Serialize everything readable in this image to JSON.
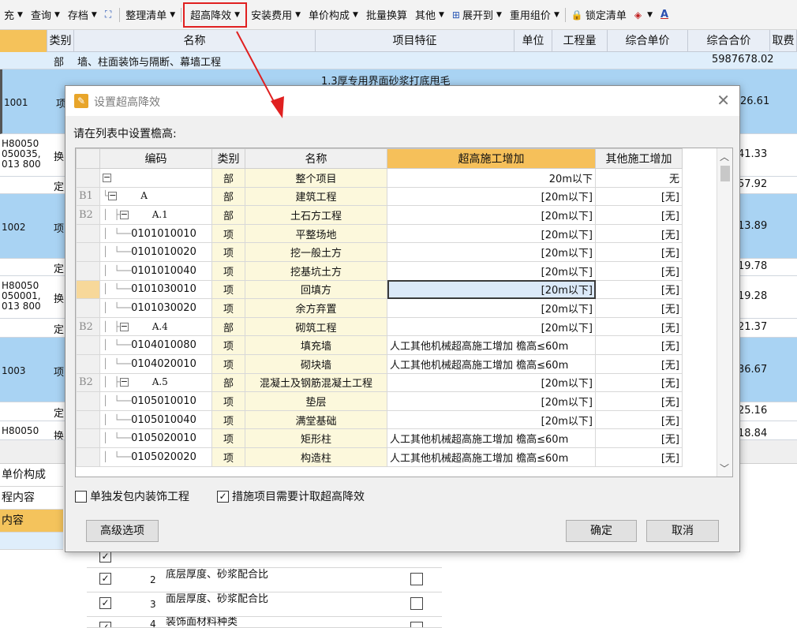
{
  "toolbar": {
    "items": [
      {
        "label": "充",
        "arrow": true
      },
      {
        "label": "查询",
        "arrow": true
      },
      {
        "label": "存档",
        "arrow": true
      },
      {
        "label": "整理清单",
        "arrow": true
      },
      {
        "label": "超高降效",
        "arrow": true
      },
      {
        "label": "安装费用",
        "arrow": true
      },
      {
        "label": "单价构成",
        "arrow": true
      },
      {
        "label": "批量换算"
      },
      {
        "label": "其他",
        "arrow": true
      },
      {
        "label": "展开到",
        "arrow": true
      },
      {
        "label": "重用组价",
        "arrow": true
      },
      {
        "label": "锁定清单"
      },
      {
        "label": "A"
      }
    ]
  },
  "grid": {
    "headers": [
      "类别",
      "名称",
      "项目特征",
      "单位",
      "工程量",
      "综合单价",
      "综合合价",
      "取费"
    ],
    "section_row": {
      "type": "部",
      "name": "墙、柱面装饰与隔断、幕墙工程",
      "total": "5987678.02"
    },
    "partial_feature": "1.3厚专用界面砂浆打底甩毛",
    "rows": [
      {
        "code": "1001",
        "type": "项",
        "price": "26.61"
      },
      {
        "code": "H80050\n050035,\n013 800",
        "type": "换",
        "price": "41.33"
      },
      {
        "code": "",
        "type": "定",
        "price": "57.92"
      },
      {
        "code": "1002",
        "type": "项",
        "price": "13.89"
      },
      {
        "code": "",
        "type": "定",
        "price": "19.78"
      },
      {
        "code": "H80050\n050001,\n013 800",
        "type": "换",
        "price": "19.28"
      },
      {
        "code": "",
        "type": "定",
        "price": "21.37"
      },
      {
        "code": "1003",
        "type": "项",
        "price": "36.67"
      },
      {
        "code": "",
        "type": "定",
        "price": "25.16"
      },
      {
        "code": "H80050",
        "type": "换",
        "price": "18.84"
      }
    ],
    "bottom_tabs": [
      "单价构成",
      "程内容",
      "内容"
    ],
    "lower_rows": [
      {
        "num": "2",
        "text": "底层厚度、砂浆配合比",
        "checked": true
      },
      {
        "num": "3",
        "text": "面层厚度、砂浆配合比",
        "checked": true
      },
      {
        "num": "4",
        "text": "装饰面材料种类",
        "checked": true
      }
    ]
  },
  "dialog": {
    "title": "设置超高降效",
    "close_glyph": "✕",
    "prompt": "请在列表中设置檐高:",
    "columns": [
      "编码",
      "类别",
      "名称",
      "超高施工增加",
      "其他施工增加"
    ],
    "rows": [
      {
        "idx": "",
        "code": "",
        "type": "部",
        "name": "整个项目",
        "high": "20m以下",
        "other": "无",
        "level": 0,
        "box": "−"
      },
      {
        "idx": "B1",
        "code": "A",
        "type": "部",
        "name": "建筑工程",
        "high": "[20m以下]",
        "other": "[无]",
        "level": 1,
        "box": "−"
      },
      {
        "idx": "B2",
        "code": "A.1",
        "type": "部",
        "name": "土石方工程",
        "high": "[20m以下]",
        "other": "[无]",
        "level": 2,
        "box": "−"
      },
      {
        "idx": "",
        "code": "0101010010",
        "type": "项",
        "name": "平整场地",
        "high": "[20m以下]",
        "other": "[无]",
        "level": 3
      },
      {
        "idx": "",
        "code": "0101010020",
        "type": "项",
        "name": "挖一般土方",
        "high": "[20m以下]",
        "other": "[无]",
        "level": 3
      },
      {
        "idx": "",
        "code": "0101010040",
        "type": "项",
        "name": "挖基坑土方",
        "high": "[20m以下]",
        "other": "[无]",
        "level": 3
      },
      {
        "idx": "",
        "code": "0101030010",
        "type": "项",
        "name": "回填方",
        "high": "[20m以下]",
        "other": "[无]",
        "level": 3,
        "selected": true
      },
      {
        "idx": "",
        "code": "0101030020",
        "type": "项",
        "name": "余方弃置",
        "high": "[20m以下]",
        "other": "[无]",
        "level": 3
      },
      {
        "idx": "B2",
        "code": "A.4",
        "type": "部",
        "name": "砌筑工程",
        "high": "[20m以下]",
        "other": "[无]",
        "level": 2,
        "box": "−"
      },
      {
        "idx": "",
        "code": "0104010080",
        "type": "项",
        "name": "填充墙",
        "high": "人工其他机械超高施工增加 檐高≤60m",
        "other": "[无]",
        "level": 3
      },
      {
        "idx": "",
        "code": "0104020010",
        "type": "项",
        "name": "砌块墙",
        "high": "人工其他机械超高施工增加 檐高≤60m",
        "other": "[无]",
        "level": 3
      },
      {
        "idx": "B2",
        "code": "A.5",
        "type": "部",
        "name": "混凝土及钢筋混凝土工程",
        "high": "[20m以下]",
        "other": "[无]",
        "level": 2,
        "box": "−"
      },
      {
        "idx": "",
        "code": "0105010010",
        "type": "项",
        "name": "垫层",
        "high": "[20m以下]",
        "other": "[无]",
        "level": 3
      },
      {
        "idx": "",
        "code": "0105010040",
        "type": "项",
        "name": "满堂基础",
        "high": "[20m以下]",
        "other": "[无]",
        "level": 3
      },
      {
        "idx": "",
        "code": "0105020010",
        "type": "项",
        "name": "矩形柱",
        "high": "人工其他机械超高施工增加 檐高≤60m",
        "other": "[无]",
        "level": 3
      },
      {
        "idx": "",
        "code": "0105020020",
        "type": "项",
        "name": "构造柱",
        "high": "人工其他机械超高施工增加 檐高≤60m",
        "other": "[无]",
        "level": 3
      }
    ],
    "option_decor": {
      "label": "单独发包内装饰工程",
      "checked": false
    },
    "option_measure": {
      "label": "措施项目需要计取超高降效",
      "checked": true
    },
    "advanced_button": "高级选项",
    "ok_button": "确定",
    "cancel_button": "取消"
  },
  "colors": {
    "highlight_border": "#e02020",
    "orange_header": "#f6c05a",
    "selected_row": "#a9d3f3"
  }
}
